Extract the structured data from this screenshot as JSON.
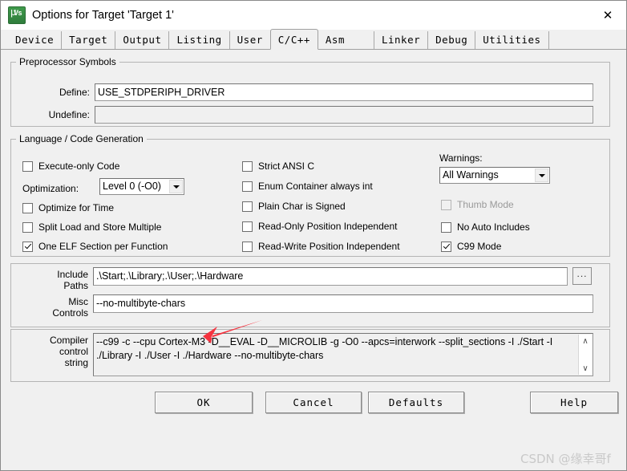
{
  "window": {
    "title": "Options for Target 'Target 1'",
    "icon": "uvision-icon",
    "close_label": "✕"
  },
  "tabs": [
    {
      "label": "Device",
      "active": false
    },
    {
      "label": "Target",
      "active": false
    },
    {
      "label": "Output",
      "active": false
    },
    {
      "label": "Listing",
      "active": false
    },
    {
      "label": "User",
      "active": false
    },
    {
      "label": "C/C++",
      "active": true
    },
    {
      "label": "Asm",
      "active": false
    },
    {
      "label": "Linker",
      "active": false
    },
    {
      "label": "Debug",
      "active": false
    },
    {
      "label": "Utilities",
      "active": false
    }
  ],
  "preprocessor": {
    "legend": "Preprocessor Symbols",
    "define_label": "Define:",
    "define_value": "USE_STDPERIPH_DRIVER",
    "undefine_label": "Undefine:",
    "undefine_value": ""
  },
  "language": {
    "legend": "Language / Code Generation",
    "optimization_label": "Optimization:",
    "optimization_value": "Level 0 (-O0)",
    "warnings_label": "Warnings:",
    "warnings_value": "All Warnings",
    "col1": [
      {
        "label": "Execute-only Code",
        "checked": false,
        "disabled": false
      },
      {
        "label": "Optimize for Time",
        "checked": false,
        "disabled": false
      },
      {
        "label": "Split Load and Store Multiple",
        "checked": false,
        "disabled": false
      },
      {
        "label": "One ELF Section per Function",
        "checked": true,
        "disabled": false
      }
    ],
    "col2": [
      {
        "label": "Strict ANSI C",
        "checked": false,
        "disabled": false
      },
      {
        "label": "Enum Container always int",
        "checked": false,
        "disabled": false
      },
      {
        "label": "Plain Char is Signed",
        "checked": false,
        "disabled": false
      },
      {
        "label": "Read-Only Position Independent",
        "checked": false,
        "disabled": false
      },
      {
        "label": "Read-Write Position Independent",
        "checked": false,
        "disabled": false
      }
    ],
    "col3": [
      {
        "label": "Thumb Mode",
        "checked": false,
        "disabled": true
      },
      {
        "label": "No Auto Includes",
        "checked": false,
        "disabled": false
      },
      {
        "label": "C99 Mode",
        "checked": true,
        "disabled": false
      }
    ]
  },
  "paths": {
    "include_label_line1": "Include",
    "include_label_line2": "Paths",
    "include_value": ".\\Start;.\\Library;.\\User;.\\Hardware",
    "browse_label": "...",
    "misc_label_line1": "Misc",
    "misc_label_line2": "Controls",
    "misc_value": "--no-multibyte-chars"
  },
  "compiler_string": {
    "label_line1": "Compiler",
    "label_line2": "control",
    "label_line3": "string",
    "value_line1": "--c99 -c --cpu Cortex-M3 -D__EVAL -D__MICROLIB -g -O0 --apcs=interwork --split_sections -I ./Start -I",
    "value_line2": "./Library -I ./User -I ./Hardware --no-multibyte-chars",
    "scroll_up": "∧",
    "scroll_down": "∨"
  },
  "buttons": {
    "ok": "OK",
    "cancel": "Cancel",
    "defaults": "Defaults",
    "help": "Help"
  },
  "annotation": {
    "arrow_color": "#f5333f"
  },
  "watermark": {
    "text": "CSDN @缘幸哥f"
  }
}
